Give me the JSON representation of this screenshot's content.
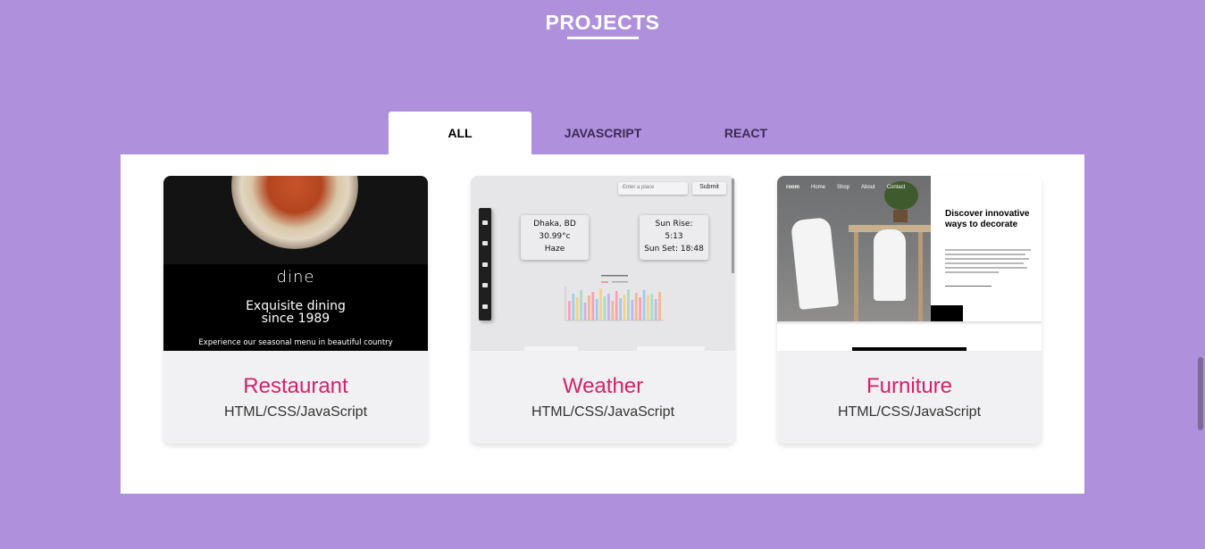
{
  "section": {
    "title": "PROJECTS"
  },
  "tabs": [
    {
      "label": "ALL",
      "active": true
    },
    {
      "label": "JAVASCRIPT",
      "active": false
    },
    {
      "label": "REACT",
      "active": false
    }
  ],
  "projects": [
    {
      "name": "Restaurant",
      "tech": "HTML/CSS/JavaScript",
      "preview": {
        "logo": "dine",
        "headline_line1": "Exquisite dining",
        "headline_line2": "since 1989",
        "subtext": "Experience our seasonal menu in beautiful country"
      }
    },
    {
      "name": "Weather",
      "tech": "HTML/CSS/JavaScript",
      "preview": {
        "search_placeholder": "Enter a place",
        "submit_label": "Submit",
        "location": "Dhaka, BD",
        "temperature": "30.99°c",
        "condition": "Haze",
        "sunrise_label": "Sun Rise:",
        "sunrise_time": "5:13",
        "sunset": "Sun Set: 18:48"
      }
    },
    {
      "name": "Furniture",
      "tech": "HTML/CSS/JavaScript",
      "preview": {
        "brand": "room",
        "nav": [
          "Home",
          "Shop",
          "About",
          "Contact"
        ],
        "headline": "Discover innovative ways to decorate"
      }
    }
  ],
  "colors": {
    "page_bg": "#ae90dc",
    "project_name": "#d4226a",
    "panel_bg": "#ffffff"
  }
}
